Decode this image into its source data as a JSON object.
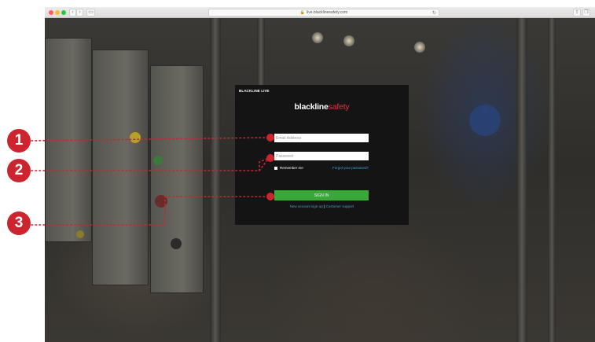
{
  "browser": {
    "url": "live.blacklinesafety.com"
  },
  "panel": {
    "title": "BLACKLINE LIVE",
    "logo_primary": "blackline",
    "logo_secondary": "safety",
    "email_placeholder": "Email Address",
    "password_placeholder": "Password",
    "remember_label": "Remember me",
    "forgot_link": "Forgot your password?",
    "signin_label": "SIGN IN",
    "signup_link": "New account sign-up",
    "separator": " | ",
    "support_link": "Customer support"
  },
  "callouts": [
    {
      "label": "1"
    },
    {
      "label": "2"
    },
    {
      "label": "3"
    }
  ],
  "colors": {
    "accent_red": "#cc2530",
    "signin_green": "#3aa839",
    "link_blue": "#3fa1d9"
  }
}
